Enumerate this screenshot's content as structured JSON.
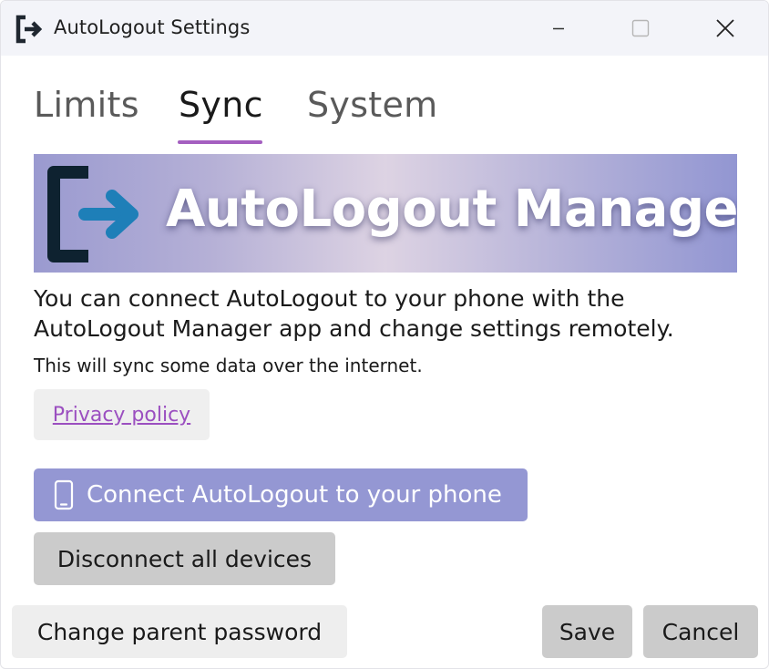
{
  "window": {
    "title": "AutoLogout Settings"
  },
  "tabs": [
    {
      "label": "Limits",
      "active": false
    },
    {
      "label": "Sync",
      "active": true
    },
    {
      "label": "System",
      "active": false
    }
  ],
  "banner": {
    "title": "AutoLogout Manager"
  },
  "sync": {
    "description": "You can connect AutoLogout to your phone with the AutoLogout Manager app and change settings remotely.",
    "note": "This will sync some data over the internet.",
    "privacy_label": "Privacy policy",
    "connect_label": "Connect AutoLogout to your phone",
    "disconnect_label": "Disconnect all devices"
  },
  "footer": {
    "change_password_label": "Change parent password",
    "save_label": "Save",
    "cancel_label": "Cancel"
  },
  "colors": {
    "accent": "#a45fc0",
    "connect_button": "#9497d3",
    "link": "#9b4fc0",
    "logo_dark": "#0e2230",
    "logo_arrow": "#1e7fb8"
  },
  "icons": {
    "app": "logout-icon",
    "minimize": "minimize-icon",
    "maximize": "maximize-icon",
    "close": "close-icon",
    "phone": "phone-icon"
  }
}
